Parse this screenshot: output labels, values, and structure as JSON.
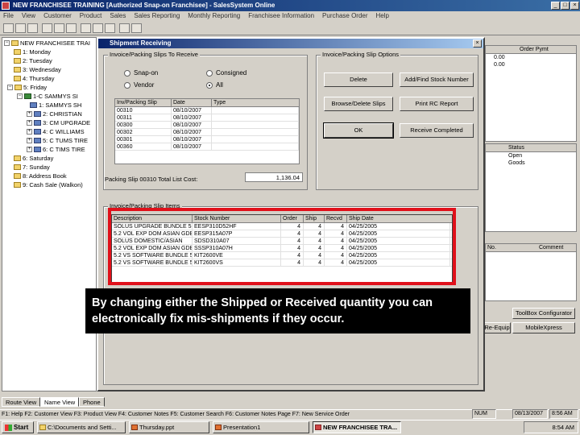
{
  "window": {
    "title": "NEW FRANCHISEE TRAINING [Authorized Snap-on Franchisee] - SalesSystem Online",
    "controls": [
      "_",
      "□",
      "×"
    ]
  },
  "menu": [
    "File",
    "View",
    "Customer",
    "Product",
    "Sales",
    "Sales Reporting",
    "Monthly Reporting",
    "Franchisee Information",
    "Purchase Order",
    "Help"
  ],
  "tree": {
    "root": "NEW FRANCHISEE TRAI",
    "items": [
      {
        "label": "1: Monday"
      },
      {
        "label": "2: Tuesday"
      },
      {
        "label": "3: Wednesday"
      },
      {
        "label": "4: Thursday"
      },
      {
        "label": "5: Friday"
      },
      {
        "label": "1-C SAMMYS SI"
      },
      {
        "label": "1: SAMMYS SH"
      },
      {
        "label": "2: CHRISTIAN"
      },
      {
        "label": "3: CM UPGRADE"
      },
      {
        "label": "4: C WILLIAMS"
      },
      {
        "label": "5: C TUMS TIRE"
      },
      {
        "label": "6: C TIMS TIRE"
      },
      {
        "label": "6: Saturday"
      },
      {
        "label": "7: Sunday"
      },
      {
        "label": "8: Address Book"
      },
      {
        "label": "9: Cash Sale (Walkon)"
      }
    ]
  },
  "background_panel": {
    "grid1_header": "Order Pymt",
    "grid1_values": [
      "0.00",
      "0.00"
    ],
    "status_header": "Status",
    "status_values": [
      "Open",
      "Goods"
    ],
    "grid3_headers": [
      "No.",
      "Comment"
    ],
    "buttons": [
      "ToolBox Configurator",
      "Re-Equip",
      "MobileXpress"
    ]
  },
  "dialog": {
    "title": "Shipment Receiving",
    "invoice_group_label": "Invoice/Packing Slips To Receive",
    "radios": [
      {
        "label": "Snap-on",
        "checked": false
      },
      {
        "label": "Consigned",
        "checked": false
      },
      {
        "label": "Vendor",
        "checked": false
      },
      {
        "label": "All",
        "checked": true
      }
    ],
    "slips_grid": {
      "headers": [
        "Inv/Packing Slip",
        "Date",
        "Type"
      ],
      "rows": [
        [
          "00310",
          "08/10/2007",
          ""
        ],
        [
          "00311",
          "08/10/2007",
          ""
        ],
        [
          "00300",
          "08/10/2007",
          ""
        ],
        [
          "00302",
          "08/10/2007",
          ""
        ],
        [
          "00301",
          "08/10/2007",
          ""
        ],
        [
          "00360",
          "08/10/2007",
          ""
        ]
      ]
    },
    "total_label": "Packing Slip 00310 Total List Cost:",
    "total_value": "1,136.04",
    "options_group_label": "Invoice/Packing Slip Options",
    "option_buttons": [
      "Delete",
      "Add/Find Stock Number",
      "Browse/Delete Slips",
      "Print RC Report",
      "OK",
      "Receive Completed"
    ],
    "items_group_label": "Invoice/Packing Slip Items",
    "items_grid": {
      "headers": [
        "Description",
        "Stock Number",
        "Order",
        "Ship",
        "Recvd",
        "Ship Date"
      ],
      "rows": [
        [
          "SOLUS UPGRADE BUNDLE 5.2",
          "EESP310D52HF",
          "4",
          "4",
          "4",
          "04/25/2005"
        ],
        [
          "5.2 VOL EXP DOM ASIAN GDB",
          "EESP315A07P",
          "4",
          "4",
          "4",
          "04/25/2005"
        ],
        [
          "SOLUS DOMESTIC/ASIAN",
          "SDSD310A07",
          "4",
          "4",
          "4",
          "04/25/2005"
        ],
        [
          "5.2 VOL EXP DOM ASIAN GDB",
          "SSSP310A07H",
          "4",
          "4",
          "4",
          "04/25/2005"
        ],
        [
          "5.2 VS SOFTWARE BUNDLE 5",
          "KIT2600VE",
          "4",
          "4",
          "4",
          "04/25/2005"
        ],
        [
          "5.2 VS SOFTWARE BUNDLE 5",
          "KIT2600VS",
          "4",
          "4",
          "4",
          "04/25/2005"
        ]
      ]
    }
  },
  "caption": "By changing either the Shipped or Received quantity you can electronically fix mis-shipments if they occur.",
  "bottom_tabs": [
    "Route View",
    "Name View",
    "Phone"
  ],
  "statusbar": {
    "text": "F1: Help  F2: Customer View  F3: Product View  F4: Customer Notes  F5: Customer Search  F6: Customer Notes Page  F7: New Service Order",
    "num": "NUM",
    "date": "08/13/2007",
    "time": "8:56 AM"
  },
  "taskbar": {
    "start": "Start",
    "tasks": [
      {
        "label": "C:\\Documents and Setti...",
        "active": false
      },
      {
        "label": "Thursday.ppt",
        "active": false
      },
      {
        "label": "Presentation1",
        "active": false
      },
      {
        "label": "NEW FRANCHISEE TRA...",
        "active": true
      }
    ],
    "clock": "8:54 AM"
  }
}
